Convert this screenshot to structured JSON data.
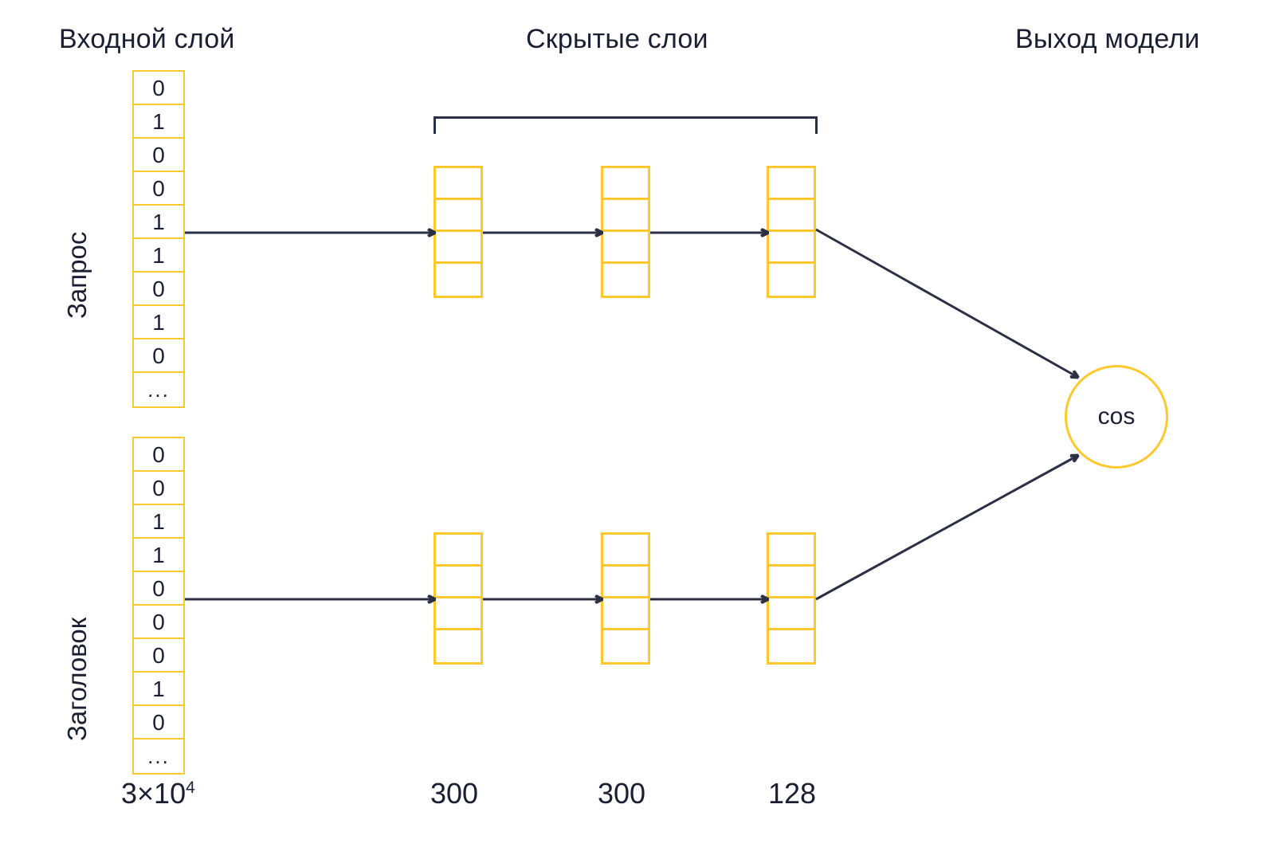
{
  "headers": {
    "input": "Входной слой",
    "hidden": "Скрытые слои",
    "output": "Выход модели"
  },
  "side_labels": {
    "query": "Запрос",
    "title": "Заголовок"
  },
  "input_vectors": {
    "query": {
      "label": "Запрос",
      "cells": [
        "0",
        "1",
        "0",
        "0",
        "1",
        "1",
        "0",
        "1",
        "0",
        "..."
      ]
    },
    "title": {
      "label": "Заголовок",
      "cells": [
        "0",
        "0",
        "1",
        "1",
        "0",
        "0",
        "0",
        "1",
        "0",
        "..."
      ]
    }
  },
  "hidden_layers": [
    {
      "name": "hidden-1",
      "cells": 4,
      "dim_label": "300"
    },
    {
      "name": "hidden-2",
      "cells": 4,
      "dim_label": "300"
    },
    {
      "name": "hidden-3",
      "cells": 4,
      "dim_label": "128"
    }
  ],
  "dimensions": {
    "input": "3×10",
    "input_exponent": "4",
    "hidden_1": "300",
    "hidden_2": "300",
    "hidden_3": "128"
  },
  "output": {
    "node_label": "cos"
  },
  "colors": {
    "accent": "#ffc82c",
    "ink": "#1a1f33",
    "arrow": "#2b3044",
    "background": "#ffffff"
  }
}
